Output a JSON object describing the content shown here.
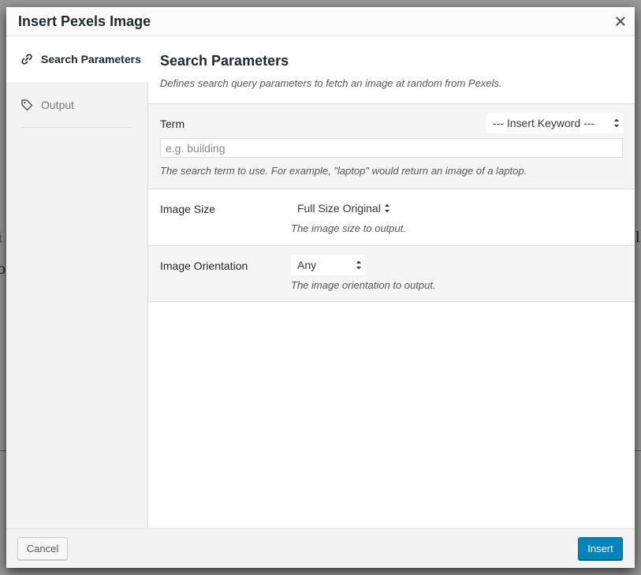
{
  "modal": {
    "title": "Insert Pexels Image",
    "close_label": "×"
  },
  "sidebar": {
    "items": [
      {
        "label": "Search Parameters",
        "icon": "link-icon",
        "active": true
      },
      {
        "label": "Output",
        "icon": "tag-icon",
        "active": false
      }
    ]
  },
  "content": {
    "title": "Search Parameters",
    "description": "Defines search query parameters to fetch an image at random from Pexels.",
    "term": {
      "label": "Term",
      "keyword_select": "--- Insert Keyword ---",
      "placeholder": "e.g. building",
      "value": "",
      "hint": "The search term to use. For example, \"laptop\" would return an image of a laptop."
    },
    "image_size": {
      "label": "Image Size",
      "selected": "Full Size Original",
      "hint": "The image size to output."
    },
    "image_orientation": {
      "label": "Image Orientation",
      "selected": "Any",
      "hint": "The image orientation to output."
    }
  },
  "footer": {
    "cancel_label": "Cancel",
    "insert_label": "Insert"
  },
  "colors": {
    "primary_button": "#0085ba",
    "sidebar_bg": "#f3f3f3",
    "row_grey": "#f5f5f5"
  }
}
